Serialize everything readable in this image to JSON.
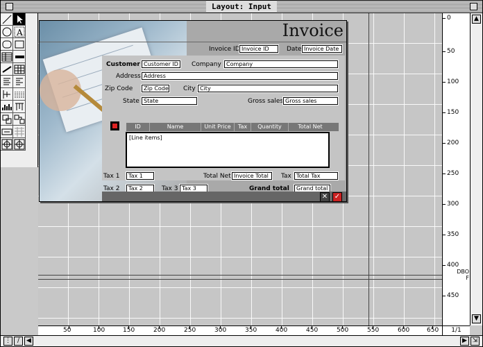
{
  "window": {
    "title": "Layout: Input"
  },
  "colors": {
    "canvas": "#c6c6c6",
    "header": "#777777",
    "accent": "#cc2222"
  },
  "tools": [
    "pointer-tool",
    "line-tool",
    "text-tool",
    "oval-tool",
    "rectangle-tool",
    "rounded-rectangle-tool",
    "table-tool",
    "field-tool",
    "list-tool",
    "button-tool",
    "checkbox-tool",
    "radio-tool",
    "popup-tool",
    "combo-tool",
    "separator-tool",
    "tab-tool",
    "graph-tool",
    "slider-tool",
    "plugin-tool",
    "subform-tool",
    "web-tool",
    "group-tool",
    "ungroup-tool",
    "grid-tool"
  ],
  "invoice": {
    "title": "Invoice",
    "invoice_id_label": "Invoice ID",
    "invoice_id_field": "Invoice ID",
    "date_label": "Date",
    "date_field": "Invoice Date",
    "customer_label": "Customer",
    "customer_field": "Customer ID",
    "company_label": "Company",
    "company_field": "Company",
    "address_label": "Address",
    "address_field": "Address",
    "zip_label": "Zip Code",
    "zip_field": "Zip Code",
    "city_label": "City",
    "city_field": "City",
    "state_label": "State",
    "state_field": "State",
    "gross_label": "Gross sales",
    "gross_field": "Gross sales",
    "line_columns": [
      "ID",
      "Name",
      "Unit Price",
      "Tax",
      "Quantity",
      "Total Net"
    ],
    "line_items_placeholder": "[Line items]",
    "tax1_label": "Tax 1",
    "tax1_field": "Tax 1",
    "tax2_label": "Tax 2",
    "tax2_field": "Tax 2",
    "tax3_label": "Tax 3",
    "tax3_field": "Tax 3",
    "total_net_label": "Total Net",
    "total_net_field": "Invoice Total",
    "tax_label": "Tax",
    "tax_field": "Total Tax",
    "grand_total_label": "Grand total",
    "grand_total_field": "Grand total"
  },
  "ruler_right": {
    "top_label": "0",
    "ticks": [
      "50",
      "100",
      "150",
      "200",
      "250",
      "300",
      "350",
      "400",
      "450"
    ],
    "marker_label": "DBO",
    "marker_sub": "F"
  },
  "ruler_bottom": {
    "ticks": [
      "50",
      "100",
      "150",
      "200",
      "250",
      "300",
      "350",
      "400",
      "450",
      "500",
      "550",
      "600",
      "650"
    ]
  },
  "page_count": "1/1"
}
